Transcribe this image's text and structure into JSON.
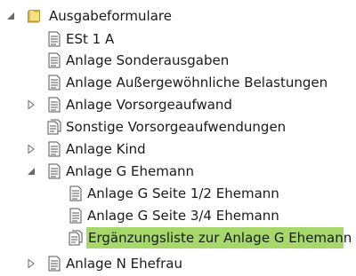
{
  "tree": {
    "root": {
      "label": "Ausgabeformulare",
      "icon": "folder-icon",
      "expanded": true
    },
    "items": [
      {
        "label": "ESt 1 A",
        "icon": "document-icon"
      },
      {
        "label": "Anlage Sonderausgaben",
        "icon": "document-icon"
      },
      {
        "label": "Anlage Außergewöhnliche Belastungen",
        "icon": "document-icon"
      },
      {
        "label": "Anlage Vorsorgeaufwand",
        "icon": "document-icon",
        "expanded": false
      },
      {
        "label": "Sonstige Vorsorgeaufwendungen",
        "icon": "document-stack-icon"
      },
      {
        "label": "Anlage Kind",
        "icon": "document-icon",
        "expanded": false
      },
      {
        "label": "Anlage G Ehemann",
        "icon": "document-icon",
        "expanded": true
      },
      {
        "label": "Anlage G Seite 1/2 Ehemann",
        "icon": "document-icon"
      },
      {
        "label": "Anlage G Seite 3/4 Ehemann",
        "icon": "document-icon"
      },
      {
        "label": "Ergänzungsliste zur Anlage G Ehemann",
        "icon": "document-stack-icon",
        "selected": true
      },
      {
        "label": "Anlage N Ehefrau",
        "icon": "document-icon",
        "expanded": false
      }
    ]
  },
  "colors": {
    "selection": "#a6d96a",
    "folder": "#e8c84a",
    "expander": "#7a7a7a"
  }
}
